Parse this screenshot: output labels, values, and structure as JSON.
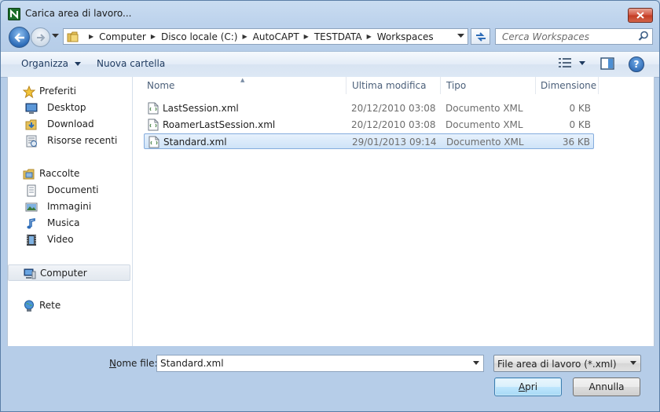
{
  "window": {
    "title": "Carica area di lavoro...",
    "icons": {
      "app": "app-n-icon",
      "close": "close-icon"
    }
  },
  "address_bar": {
    "crumbs": [
      "Computer",
      "Disco locale (C:)",
      "AutoCAPT",
      "TESTDATA",
      "Workspaces"
    ],
    "search_placeholder": "Cerca Workspaces"
  },
  "toolbar": {
    "organize_label": "Organizza",
    "new_folder_label": "Nuova cartella"
  },
  "sidebar": {
    "favorites_label": "Preferiti",
    "favorites": [
      "Desktop",
      "Download",
      "Risorse recenti"
    ],
    "libraries_label": "Raccolte",
    "libraries": [
      "Documenti",
      "Immagini",
      "Musica",
      "Video"
    ],
    "computer_label": "Computer",
    "network_label": "Rete"
  },
  "file_list": {
    "columns": [
      "Nome",
      "Ultima modifica",
      "Tipo",
      "Dimensione"
    ],
    "rows": [
      {
        "name": "LastSession.xml",
        "modified": "20/12/2010 03:08",
        "type": "Documento XML",
        "size": "0 KB"
      },
      {
        "name": "RoamerLastSession.xml",
        "modified": "20/12/2010 03:08",
        "type": "Documento XML",
        "size": "0 KB"
      },
      {
        "name": "Standard.xml",
        "modified": "29/01/2013 09:14",
        "type": "Documento XML",
        "size": "36 KB"
      }
    ],
    "selected_index": 2
  },
  "footer": {
    "filename_label_mnemonic": "N",
    "filename_label_rest": "ome file:",
    "filename_value": "Standard.xml",
    "filter_value": "File area di lavoro (*.xml)",
    "open_mnemonic": "A",
    "open_rest": "pri",
    "cancel_label": "Annulla"
  },
  "colors": {
    "accent": "#2d6cb8",
    "selection": "#cee3f8",
    "selection_border": "#84acdd",
    "close_red": "#c23b22"
  }
}
